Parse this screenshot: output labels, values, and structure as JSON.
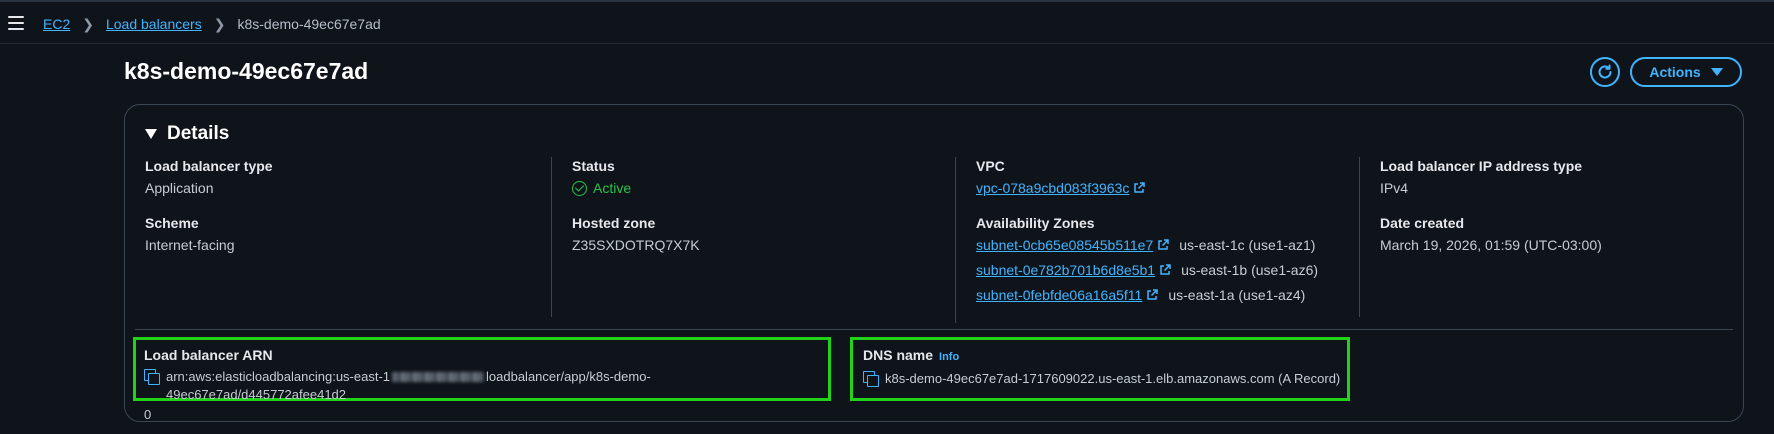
{
  "breadcrumb": {
    "items": [
      "EC2",
      "Load balancers"
    ],
    "current": "k8s-demo-49ec67e7ad"
  },
  "header": {
    "title": "k8s-demo-49ec67e7ad",
    "actions_label": "Actions"
  },
  "details": {
    "title": "Details",
    "lb_type_label": "Load balancer type",
    "lb_type_value": "Application",
    "scheme_label": "Scheme",
    "scheme_value": "Internet-facing",
    "status_label": "Status",
    "status_value": "Active",
    "hosted_zone_label": "Hosted zone",
    "hosted_zone_value": "Z35SXDOTRQ7X7K",
    "vpc_label": "VPC",
    "vpc_value": "vpc-078a9cbd083f3963c",
    "az_label": "Availability Zones",
    "azs": [
      {
        "subnet": "subnet-0cb65e08545b511e7",
        "zone": "us-east-1c (use1-az1)"
      },
      {
        "subnet": "subnet-0e782b701b6d8e5b1",
        "zone": "us-east-1b (use1-az6)"
      },
      {
        "subnet": "subnet-0febfde06a16a5f11",
        "zone": "us-east-1a (use1-az4)"
      }
    ],
    "ip_type_label": "Load balancer IP address type",
    "ip_type_value": "IPv4",
    "date_label": "Date created",
    "date_value": "March 19, 2026, 01:59 (UTC-03:00)",
    "arn_label": "Load balancer ARN",
    "arn_prefix": "arn:aws:elasticloadbalancing:us-east-1",
    "arn_suffix": "loadbalancer/app/k8s-demo-49ec67e7ad/d445772afee41d2",
    "arn_wrap": "0",
    "dns_label": "DNS name",
    "dns_info": "Info",
    "dns_value": "k8s-demo-49ec67e7ad-1717609022.us-east-1.elb.amazonaws.com (A Record)"
  },
  "colors": {
    "accent": "#42b4ff",
    "success": "#29c44a",
    "highlight": "#22d11a",
    "background": "#0f141a"
  }
}
